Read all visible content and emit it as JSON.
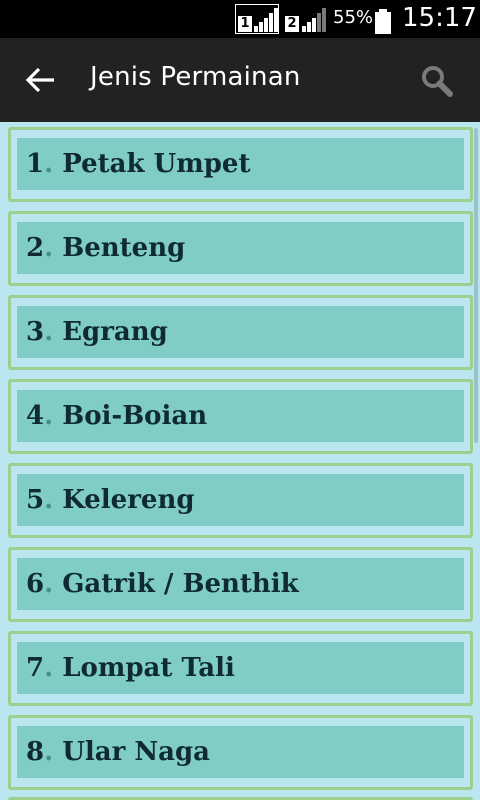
{
  "status_bar": {
    "sim1_label": "1",
    "sim2_label": "2",
    "battery_percent": "55%",
    "time": "15:17"
  },
  "app_bar": {
    "title": "Jenis Permainan",
    "back_icon": "arrow-left-icon",
    "search_icon": "search-icon"
  },
  "games": [
    {
      "number": "1",
      "name": "Petak Umpet"
    },
    {
      "number": "2",
      "name": "Benteng"
    },
    {
      "number": "3",
      "name": "Egrang"
    },
    {
      "number": "4",
      "name": "Boi-Boian"
    },
    {
      "number": "5",
      "name": "Kelereng"
    },
    {
      "number": "6",
      "name": "Gatrik / Benthik"
    },
    {
      "number": "7",
      "name": "Lompat Tali"
    },
    {
      "number": "8",
      "name": "Ular Naga"
    }
  ],
  "colors": {
    "status_bar_bg": "#000000",
    "app_bar_bg": "#222222",
    "list_bg": "#b9e6ef",
    "item_border": "#9ccf8f",
    "item_fill": "#7fcdc4",
    "item_text": "#0f2a33"
  }
}
